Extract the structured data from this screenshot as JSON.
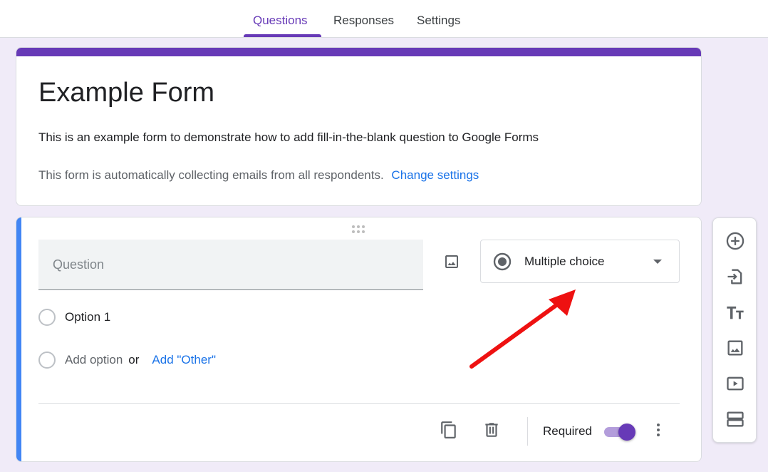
{
  "tabs": [
    {
      "label": "Questions",
      "active": true
    },
    {
      "label": "Responses",
      "active": false
    },
    {
      "label": "Settings",
      "active": false
    }
  ],
  "form": {
    "title": "Example Form",
    "description": "This is an example form to demonstrate how to add fill-in-the-blank question to Google Forms",
    "email_note": "This form is automatically collecting emails from all respondents.",
    "change_settings": "Change settings"
  },
  "question": {
    "placeholder": "Question",
    "type": "Multiple choice",
    "options": [
      "Option 1"
    ],
    "add_option": "Add option",
    "or": "or",
    "add_other": "Add \"Other\"",
    "required_label": "Required",
    "required": true
  },
  "icons": {
    "drag": "drag-handle-icon",
    "image": "image-icon",
    "type": "radio-button-icon",
    "caret": "dropdown-caret-icon",
    "duplicate": "copy-icon",
    "delete": "trash-icon",
    "more": "more-vert-icon",
    "toolbar": [
      "add-question-icon",
      "import-questions-icon",
      "add-title-icon",
      "add-image-icon",
      "add-video-icon",
      "add-section-icon"
    ]
  },
  "colors": {
    "theme": "#673ab7",
    "background": "#f0ebf8",
    "active_question": "#4285f4",
    "link": "#1a73e8",
    "annotation_arrow": "#ee1111"
  }
}
